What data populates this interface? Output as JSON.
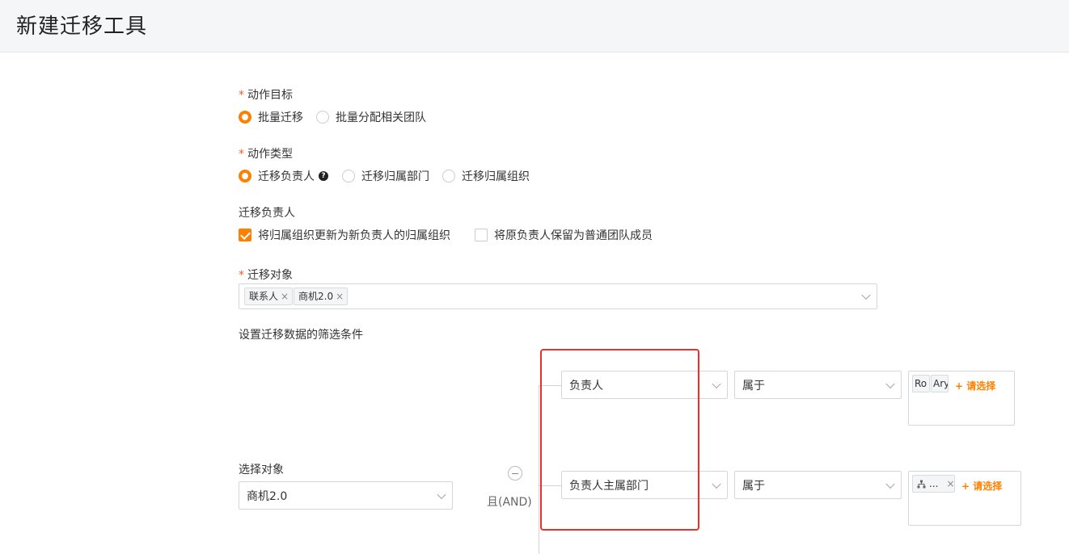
{
  "header": {
    "title": "新建迁移工具"
  },
  "action_target": {
    "label": "动作目标",
    "required_mark": "*",
    "options": [
      {
        "label": "批量迁移",
        "selected": true
      },
      {
        "label": "批量分配相关团队",
        "selected": false
      }
    ]
  },
  "action_type": {
    "label": "动作类型",
    "required_mark": "*",
    "options": [
      {
        "label": "迁移负责人",
        "selected": true
      },
      {
        "label": "迁移归属部门",
        "selected": false
      },
      {
        "label": "迁移归属组织",
        "selected": false
      }
    ],
    "help_glyph": "?"
  },
  "owner_section": {
    "label": "迁移负责人",
    "checkboxes": [
      {
        "label": "将归属组织更新为新负责人的归属组织",
        "checked": true
      },
      {
        "label": "将原负责人保留为普通团队成员",
        "checked": false
      }
    ]
  },
  "migrate_objects": {
    "label": "迁移对象",
    "required_mark": "*",
    "tags": [
      {
        "label": "联系人",
        "remove": "×"
      },
      {
        "label": "商机2.0",
        "remove": "×"
      }
    ]
  },
  "filter_section": {
    "label": "设置迁移数据的筛选条件"
  },
  "select_object": {
    "label": "选择对象",
    "value": "商机2.0"
  },
  "logic": {
    "label": "且(AND)"
  },
  "conditions": [
    {
      "field": "负责人",
      "operator": "属于",
      "values": [
        "Ro",
        "Ary"
      ],
      "add_label": "+ 请选择"
    },
    {
      "field": "负责人主属部门",
      "operator": "属于",
      "values": [
        "..."
      ],
      "value_remove": "×",
      "add_label": "+ 请选择"
    }
  ],
  "colors": {
    "accent": "#ff8000",
    "highlight": "#e8312a",
    "required": "#ff5a1f"
  }
}
